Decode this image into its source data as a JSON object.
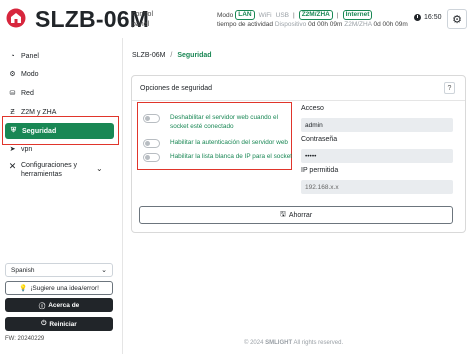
{
  "header": {
    "brand": "SLZB-06M",
    "brand_sub_1": "control",
    "brand_sub_2": "panel",
    "mode_label": "Modo",
    "mode_lan": "LAN",
    "mode_wifi": "WiFi",
    "mode_usb": "USB",
    "z2m": "Z2M/ZHA",
    "internet": "Internet",
    "uptime_label": "tiempo de actividad",
    "device_label": "Dispositivo",
    "device_uptime": "0d 00h 09m",
    "z2m_label": "Z2M/ZHA",
    "z2m_uptime": "0d 00h 09m",
    "time": "16:50"
  },
  "sidebar": {
    "items": [
      {
        "label": "Panel",
        "icon": "dashboard-icon"
      },
      {
        "label": "Modo",
        "icon": "gear-icon"
      },
      {
        "label": "Red",
        "icon": "network-icon"
      },
      {
        "label": "Z2M y ZHA",
        "icon": "zigbee-icon"
      },
      {
        "label": "Seguridad",
        "icon": "shield-icon"
      },
      {
        "label": "vpn",
        "icon": "vpn-icon"
      },
      {
        "label": "Configuraciones y herramientas",
        "icon": "tools-icon"
      }
    ],
    "config_line_1": "Configuraciones y",
    "config_line_2": "herramientas",
    "language": "Spanish",
    "suggest_button": "¡Sugiere una idea/error!",
    "about_button": "Acerca de",
    "restart_button": "Reiniciar",
    "fw": "FW: 20240229"
  },
  "main": {
    "breadcrumb_root": "SLZB-06M",
    "breadcrumb_current": "Seguridad",
    "card_title": "Opciones de seguridad",
    "help": "?",
    "toggles": [
      {
        "label_1": "Deshabilitar el servidor web cuando el",
        "label_2": "socket esté conectado"
      },
      {
        "label_1": "Habilitar la autenticación del servidor web"
      },
      {
        "label_1": "Habilitar la lista blanca de IP para el socket"
      }
    ],
    "access_label": "Acceso",
    "username": "admin",
    "password_label": "Contraseña",
    "password_mask": "•••••",
    "ip_label": "IP permitida",
    "ip_value": "192.168.x.x",
    "save_button": "Ahorrar",
    "footer_copy": "© 2024",
    "footer_brand": "SMLIGHT",
    "footer_rights": "All rights reserved."
  },
  "colors": {
    "accent": "#198754",
    "highlight": "#e0352b",
    "dark_button": "#212529"
  }
}
